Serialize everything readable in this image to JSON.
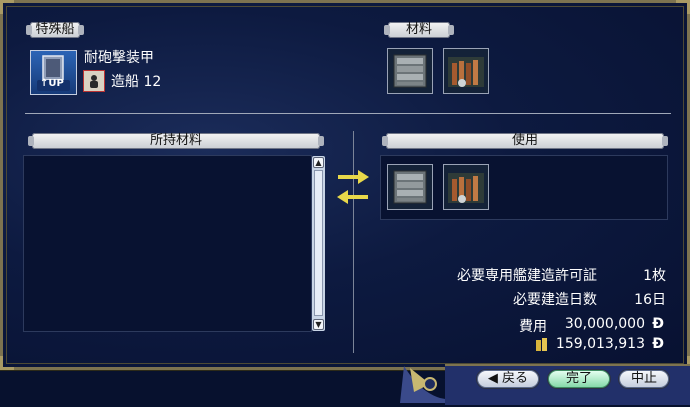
{
  "ship": {
    "section_title": "特殊船",
    "name": "耐砲撃装甲",
    "skill_label": "造船 12",
    "up_label": "↑UP",
    "icon": "armor-book-icon",
    "skill_icon": "shipbuilding-scroll-icon"
  },
  "materials": {
    "section_title": "材料",
    "items": [
      {
        "icon": "iron-plates-icon"
      },
      {
        "icon": "lumber-tools-icon"
      }
    ]
  },
  "inventory": {
    "section_title": "所持材料"
  },
  "usage": {
    "section_title": "使用",
    "items": [
      {
        "icon": "iron-plates-icon"
      },
      {
        "icon": "lumber-tools-icon"
      }
    ]
  },
  "transfer": {
    "to_right_icon": "arrow-right-icon",
    "to_left_icon": "arrow-left-icon"
  },
  "requirements": {
    "permit_label": "必要専用艦建造許可証",
    "permit_value": "1枚",
    "days_label": "必要建造日数",
    "days_value": "16日",
    "cost_label": "費用",
    "cost_value": "30,000,000",
    "cost_currency": "Ð",
    "money_icon": "money-bag-icon",
    "money_value": "159,013,913",
    "money_currency": "Ð"
  },
  "buttons": {
    "back": "◀ 戻る",
    "done": "完了",
    "cancel": "中止"
  },
  "colors": {
    "arrow": "#e8d84a",
    "window_border": "#7d7350",
    "button_green": "#86d9a9"
  }
}
